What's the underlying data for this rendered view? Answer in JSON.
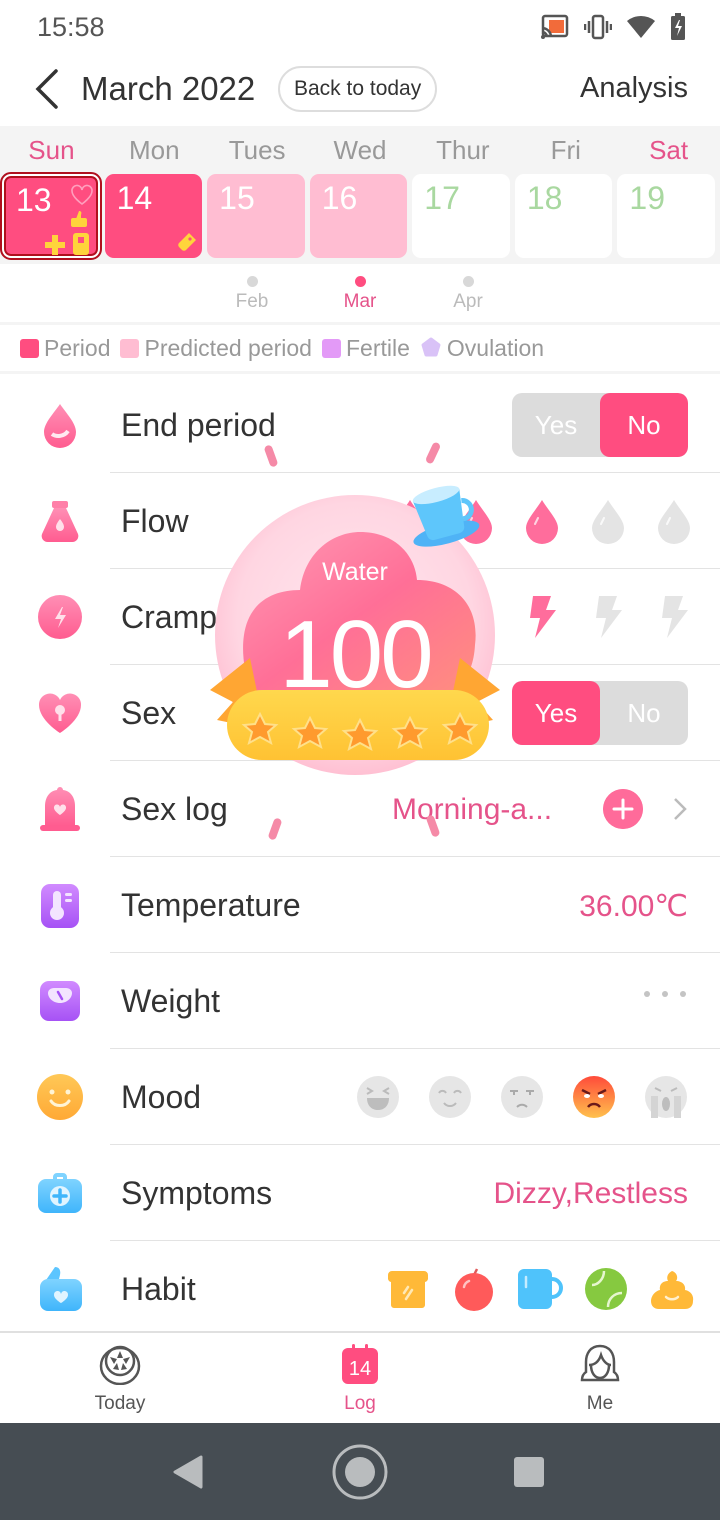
{
  "status_bar": {
    "time": "15:58",
    "icons": [
      "cast-icon",
      "vibrate-icon",
      "wifi-icon",
      "battery-charging-icon"
    ]
  },
  "header": {
    "title": "March 2022",
    "back_to_today": "Back to today",
    "analysis": "Analysis",
    "back_icon": "chevron-left-icon"
  },
  "calendar": {
    "weekdays": [
      "Sun",
      "Mon",
      "Tues",
      "Wed",
      "Thur",
      "Fri",
      "Sat"
    ],
    "days": [
      {
        "num": "13",
        "type": "period",
        "selected": true,
        "markers": [
          "heart-outline-icon",
          "thumbs-up-icon",
          "plus-icon",
          "condom-icon"
        ]
      },
      {
        "num": "14",
        "type": "period",
        "selected": false,
        "markers": [
          "tag-icon"
        ]
      },
      {
        "num": "15",
        "type": "predicted",
        "selected": false,
        "markers": []
      },
      {
        "num": "16",
        "type": "predicted",
        "selected": false,
        "markers": []
      },
      {
        "num": "17",
        "type": "future",
        "selected": false,
        "markers": []
      },
      {
        "num": "18",
        "type": "future",
        "selected": false,
        "markers": []
      },
      {
        "num": "19",
        "type": "future",
        "selected": false,
        "markers": []
      }
    ],
    "months": [
      {
        "label": "Feb",
        "active": false
      },
      {
        "label": "Mar",
        "active": true
      },
      {
        "label": "Apr",
        "active": false
      }
    ]
  },
  "legend": [
    {
      "label": "Period",
      "color": "#ff4d80"
    },
    {
      "label": "Predicted period",
      "color": "#ffbdd2"
    },
    {
      "label": "Fertile",
      "color": "#e39af7"
    },
    {
      "label": "Ovulation",
      "color": "#d9c2f7"
    }
  ],
  "rows": {
    "end_period": {
      "label": "End period",
      "yes": "Yes",
      "no": "No",
      "selected": "No"
    },
    "flow": {
      "label": "Flow",
      "level": 3,
      "max": 5
    },
    "cramps": {
      "label": "Cramps",
      "level": 3,
      "max": 5
    },
    "sex": {
      "label": "Sex",
      "yes": "Yes",
      "no": "No",
      "selected": "Yes"
    },
    "sex_log": {
      "label": "Sex log",
      "value": "Morning-a..."
    },
    "temperature": {
      "label": "Temperature",
      "value": "36.00℃"
    },
    "weight": {
      "label": "Weight",
      "value": "..."
    },
    "mood": {
      "label": "Mood",
      "options": [
        "laughing",
        "happy",
        "annoyed",
        "angry",
        "crying"
      ],
      "selected": "angry"
    },
    "symptoms": {
      "label": "Symptoms",
      "value": "Dizzy,Restless"
    },
    "habit": {
      "label": "Habit",
      "options": [
        "toast-icon",
        "apple-icon",
        "cup-icon",
        "ball-icon",
        "poop-icon"
      ]
    }
  },
  "popup": {
    "title": "Water",
    "value": "100",
    "stars": 5
  },
  "bottom_nav": [
    {
      "label": "Today",
      "icon": "lemon-icon",
      "active": false
    },
    {
      "label": "Log",
      "icon": "calendar-icon",
      "icon_text": "14",
      "active": true
    },
    {
      "label": "Me",
      "icon": "profile-icon",
      "active": false
    }
  ],
  "colors": {
    "accent": "#ff4d80",
    "accent_text": "#e5538a",
    "future_day": "#a9d8a0"
  }
}
